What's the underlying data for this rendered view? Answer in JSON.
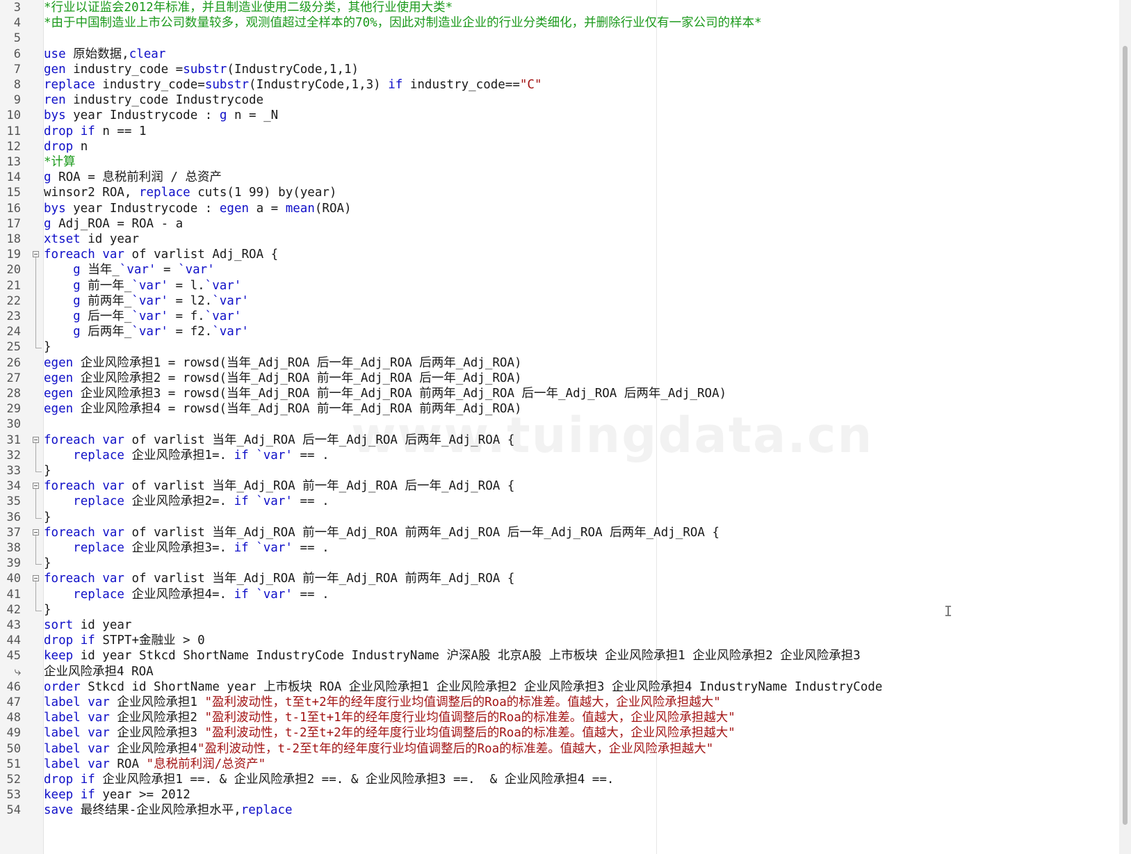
{
  "editor": {
    "watermark": "www.tuingdata.cn",
    "lines": [
      {
        "no": "3",
        "segs": [
          {
            "t": "*行业以证监会2012年标准，并且制造业使用二级分类，其他行业使用大类*",
            "c": "cm"
          }
        ]
      },
      {
        "no": "4",
        "segs": [
          {
            "t": "*由于中国制造业上市公司数量较多，观测值超过全样本的70%，因此对制造业企业的行业分类细化，并删除行业仅有一家公司的样本*",
            "c": "cm"
          }
        ]
      },
      {
        "no": "5",
        "segs": []
      },
      {
        "no": "6",
        "segs": [
          {
            "t": "use",
            "c": "kw"
          },
          {
            "t": " 原始数据,"
          },
          {
            "t": "clear",
            "c": "kw"
          }
        ]
      },
      {
        "no": "7",
        "segs": [
          {
            "t": "gen",
            "c": "kw"
          },
          {
            "t": " industry_code ="
          },
          {
            "t": "substr",
            "c": "kw"
          },
          {
            "t": "(IndustryCode,1,1)"
          }
        ]
      },
      {
        "no": "8",
        "segs": [
          {
            "t": "replace",
            "c": "kw"
          },
          {
            "t": " industry_code="
          },
          {
            "t": "substr",
            "c": "kw"
          },
          {
            "t": "(IndustryCode,1,3) "
          },
          {
            "t": "if",
            "c": "kw"
          },
          {
            "t": " industry_code=="
          },
          {
            "t": "\"C\"",
            "c": "str"
          }
        ]
      },
      {
        "no": "9",
        "segs": [
          {
            "t": "ren",
            "c": "kw"
          },
          {
            "t": " industry_code Industrycode"
          }
        ]
      },
      {
        "no": "10",
        "segs": [
          {
            "t": "bys",
            "c": "kw"
          },
          {
            "t": " year Industrycode : "
          },
          {
            "t": "g",
            "c": "kw"
          },
          {
            "t": " n = _N"
          }
        ]
      },
      {
        "no": "11",
        "segs": [
          {
            "t": "drop",
            "c": "kw"
          },
          {
            "t": " "
          },
          {
            "t": "if",
            "c": "kw"
          },
          {
            "t": " n == 1"
          }
        ]
      },
      {
        "no": "12",
        "segs": [
          {
            "t": "drop",
            "c": "kw"
          },
          {
            "t": " n"
          }
        ]
      },
      {
        "no": "13",
        "segs": [
          {
            "t": "*计算",
            "c": "cm"
          }
        ]
      },
      {
        "no": "14",
        "segs": [
          {
            "t": "g",
            "c": "kw"
          },
          {
            "t": " ROA = 息税前利润 / 总资产"
          }
        ]
      },
      {
        "no": "15",
        "segs": [
          {
            "t": "winsor2 ROA, "
          },
          {
            "t": "replace",
            "c": "kw"
          },
          {
            "t": " cuts(1 99) by(year)"
          }
        ]
      },
      {
        "no": "16",
        "segs": [
          {
            "t": "bys",
            "c": "kw"
          },
          {
            "t": " year Industrycode : "
          },
          {
            "t": "egen",
            "c": "kw"
          },
          {
            "t": " a = "
          },
          {
            "t": "mean",
            "c": "kw"
          },
          {
            "t": "(ROA)"
          }
        ]
      },
      {
        "no": "17",
        "segs": [
          {
            "t": "g",
            "c": "kw"
          },
          {
            "t": " Adj_ROA = ROA - a"
          }
        ]
      },
      {
        "no": "18",
        "segs": [
          {
            "t": "xtset",
            "c": "kw"
          },
          {
            "t": " id year"
          }
        ]
      },
      {
        "no": "19",
        "segs": [
          {
            "t": "foreach",
            "c": "kw"
          },
          {
            "t": " "
          },
          {
            "t": "var",
            "c": "kw"
          },
          {
            "t": " of varlist Adj_ROA {"
          }
        ]
      },
      {
        "no": "20",
        "segs": [
          {
            "t": "    "
          },
          {
            "t": "g",
            "c": "kw"
          },
          {
            "t": " 当年_"
          },
          {
            "t": "`var'",
            "c": "kw"
          },
          {
            "t": " = "
          },
          {
            "t": "`var'",
            "c": "kw"
          }
        ]
      },
      {
        "no": "21",
        "segs": [
          {
            "t": "    "
          },
          {
            "t": "g",
            "c": "kw"
          },
          {
            "t": " 前一年_"
          },
          {
            "t": "`var'",
            "c": "kw"
          },
          {
            "t": " = l."
          },
          {
            "t": "`var'",
            "c": "kw"
          }
        ]
      },
      {
        "no": "22",
        "segs": [
          {
            "t": "    "
          },
          {
            "t": "g",
            "c": "kw"
          },
          {
            "t": " 前两年_"
          },
          {
            "t": "`var'",
            "c": "kw"
          },
          {
            "t": " = l2."
          },
          {
            "t": "`var'",
            "c": "kw"
          }
        ]
      },
      {
        "no": "23",
        "segs": [
          {
            "t": "    "
          },
          {
            "t": "g",
            "c": "kw"
          },
          {
            "t": " 后一年_"
          },
          {
            "t": "`var'",
            "c": "kw"
          },
          {
            "t": " = f."
          },
          {
            "t": "`var'",
            "c": "kw"
          }
        ]
      },
      {
        "no": "24",
        "segs": [
          {
            "t": "    "
          },
          {
            "t": "g",
            "c": "kw"
          },
          {
            "t": " 后两年_"
          },
          {
            "t": "`var'",
            "c": "kw"
          },
          {
            "t": " = f2."
          },
          {
            "t": "`var'",
            "c": "kw"
          }
        ]
      },
      {
        "no": "25",
        "segs": [
          {
            "t": "}"
          }
        ]
      },
      {
        "no": "26",
        "segs": [
          {
            "t": "egen",
            "c": "kw"
          },
          {
            "t": " 企业风险承担1 = rowsd(当年_Adj_ROA 后一年_Adj_ROA 后两年_Adj_ROA)"
          }
        ]
      },
      {
        "no": "27",
        "segs": [
          {
            "t": "egen",
            "c": "kw"
          },
          {
            "t": " 企业风险承担2 = rowsd(当年_Adj_ROA 前一年_Adj_ROA 后一年_Adj_ROA)"
          }
        ]
      },
      {
        "no": "28",
        "segs": [
          {
            "t": "egen",
            "c": "kw"
          },
          {
            "t": " 企业风险承担3 = rowsd(当年_Adj_ROA 前一年_Adj_ROA 前两年_Adj_ROA 后一年_Adj_ROA 后两年_Adj_ROA)"
          }
        ]
      },
      {
        "no": "29",
        "segs": [
          {
            "t": "egen",
            "c": "kw"
          },
          {
            "t": " 企业风险承担4 = rowsd(当年_Adj_ROA 前一年_Adj_ROA 前两年_Adj_ROA)"
          }
        ]
      },
      {
        "no": "30",
        "segs": []
      },
      {
        "no": "31",
        "segs": [
          {
            "t": "foreach",
            "c": "kw"
          },
          {
            "t": " "
          },
          {
            "t": "var",
            "c": "kw"
          },
          {
            "t": " of varlist 当年_Adj_ROA 后一年_Adj_ROA 后两年_Adj_ROA {"
          }
        ]
      },
      {
        "no": "32",
        "segs": [
          {
            "t": "    "
          },
          {
            "t": "replace",
            "c": "kw"
          },
          {
            "t": " 企业风险承担1=. "
          },
          {
            "t": "if",
            "c": "kw"
          },
          {
            "t": " "
          },
          {
            "t": "`var'",
            "c": "kw"
          },
          {
            "t": " == ."
          }
        ]
      },
      {
        "no": "33",
        "segs": [
          {
            "t": "}"
          }
        ]
      },
      {
        "no": "34",
        "segs": [
          {
            "t": "foreach",
            "c": "kw"
          },
          {
            "t": " "
          },
          {
            "t": "var",
            "c": "kw"
          },
          {
            "t": " of varlist 当年_Adj_ROA 前一年_Adj_ROA 后一年_Adj_ROA {"
          }
        ]
      },
      {
        "no": "35",
        "segs": [
          {
            "t": "    "
          },
          {
            "t": "replace",
            "c": "kw"
          },
          {
            "t": " 企业风险承担2=. "
          },
          {
            "t": "if",
            "c": "kw"
          },
          {
            "t": " "
          },
          {
            "t": "`var'",
            "c": "kw"
          },
          {
            "t": " == ."
          }
        ]
      },
      {
        "no": "36",
        "segs": [
          {
            "t": "}"
          }
        ]
      },
      {
        "no": "37",
        "segs": [
          {
            "t": "foreach",
            "c": "kw"
          },
          {
            "t": " "
          },
          {
            "t": "var",
            "c": "kw"
          },
          {
            "t": " of varlist 当年_Adj_ROA 前一年_Adj_ROA 前两年_Adj_ROA 后一年_Adj_ROA 后两年_Adj_ROA {"
          }
        ]
      },
      {
        "no": "38",
        "segs": [
          {
            "t": "    "
          },
          {
            "t": "replace",
            "c": "kw"
          },
          {
            "t": " 企业风险承担3=. "
          },
          {
            "t": "if",
            "c": "kw"
          },
          {
            "t": " "
          },
          {
            "t": "`var'",
            "c": "kw"
          },
          {
            "t": " == ."
          }
        ]
      },
      {
        "no": "39",
        "segs": [
          {
            "t": "}"
          }
        ]
      },
      {
        "no": "40",
        "segs": [
          {
            "t": "foreach",
            "c": "kw"
          },
          {
            "t": " "
          },
          {
            "t": "var",
            "c": "kw"
          },
          {
            "t": " of varlist 当年_Adj_ROA 前一年_Adj_ROA 前两年_Adj_ROA {"
          }
        ]
      },
      {
        "no": "41",
        "segs": [
          {
            "t": "    "
          },
          {
            "t": "replace",
            "c": "kw"
          },
          {
            "t": " 企业风险承担4=. "
          },
          {
            "t": "if",
            "c": "kw"
          },
          {
            "t": " "
          },
          {
            "t": "`var'",
            "c": "kw"
          },
          {
            "t": " == ."
          }
        ]
      },
      {
        "no": "42",
        "segs": [
          {
            "t": "}"
          }
        ]
      },
      {
        "no": "43",
        "segs": [
          {
            "t": "sort",
            "c": "kw"
          },
          {
            "t": " id year"
          }
        ]
      },
      {
        "no": "44",
        "segs": [
          {
            "t": "drop",
            "c": "kw"
          },
          {
            "t": " "
          },
          {
            "t": "if",
            "c": "kw"
          },
          {
            "t": " STPT+金融业 > 0"
          }
        ]
      },
      {
        "no": "45",
        "segs": [
          {
            "t": "keep",
            "c": "kw"
          },
          {
            "t": " id year Stkcd ShortName IndustryCode IndustryName 沪深A股 北京A股 上市板块 企业风险承担1 企业风险承担2 企业风险承担3"
          }
        ]
      },
      {
        "no": "⤷",
        "segs": [
          {
            "t": "企业风险承担4 ROA"
          }
        ]
      },
      {
        "no": "46",
        "segs": [
          {
            "t": "order",
            "c": "kw"
          },
          {
            "t": " Stkcd id ShortName year 上市板块 ROA 企业风险承担1 企业风险承担2 企业风险承担3 企业风险承担4 IndustryName IndustryCode"
          }
        ]
      },
      {
        "no": "47",
        "segs": [
          {
            "t": "label",
            "c": "kw"
          },
          {
            "t": " "
          },
          {
            "t": "var",
            "c": "kw"
          },
          {
            "t": " 企业风险承担1 "
          },
          {
            "t": "\"盈利波动性，t至t+2年的经年度行业均值调整后的Roa的标准差。值越大，企业风险承担越大\"",
            "c": "str"
          }
        ]
      },
      {
        "no": "48",
        "segs": [
          {
            "t": "label",
            "c": "kw"
          },
          {
            "t": " "
          },
          {
            "t": "var",
            "c": "kw"
          },
          {
            "t": " 企业风险承担2 "
          },
          {
            "t": "\"盈利波动性，t-1至t+1年的经年度行业均值调整后的Roa的标准差。值越大，企业风险承担越大\"",
            "c": "str"
          }
        ]
      },
      {
        "no": "49",
        "segs": [
          {
            "t": "label",
            "c": "kw"
          },
          {
            "t": " "
          },
          {
            "t": "var",
            "c": "kw"
          },
          {
            "t": " 企业风险承担3 "
          },
          {
            "t": "\"盈利波动性，t-2至t+2年的经年度行业均值调整后的Roa的标准差。值越大，企业风险承担越大\"",
            "c": "str"
          }
        ]
      },
      {
        "no": "50",
        "segs": [
          {
            "t": "label",
            "c": "kw"
          },
          {
            "t": " "
          },
          {
            "t": "var",
            "c": "kw"
          },
          {
            "t": " 企业风险承担4"
          },
          {
            "t": "\"盈利波动性，t-2至t年的经年度行业均值调整后的Roa的标准差。值越大，企业风险承担越大\"",
            "c": "str"
          }
        ]
      },
      {
        "no": "51",
        "segs": [
          {
            "t": "label",
            "c": "kw"
          },
          {
            "t": " "
          },
          {
            "t": "var",
            "c": "kw"
          },
          {
            "t": " ROA "
          },
          {
            "t": "\"息税前利润/总资产\"",
            "c": "str"
          }
        ]
      },
      {
        "no": "52",
        "segs": [
          {
            "t": "drop",
            "c": "kw"
          },
          {
            "t": " "
          },
          {
            "t": "if",
            "c": "kw"
          },
          {
            "t": " 企业风险承担1 ==. & 企业风险承担2 ==. & 企业风险承担3 ==.  & 企业风险承担4 ==."
          }
        ]
      },
      {
        "no": "53",
        "segs": [
          {
            "t": "keep",
            "c": "kw"
          },
          {
            "t": " "
          },
          {
            "t": "if",
            "c": "kw"
          },
          {
            "t": " year >= 2012"
          }
        ]
      },
      {
        "no": "54",
        "segs": [
          {
            "t": "save",
            "c": "kw"
          },
          {
            "t": " 最终结果-企业风险承担水平,"
          },
          {
            "t": "replace",
            "c": "kw"
          }
        ]
      }
    ]
  }
}
